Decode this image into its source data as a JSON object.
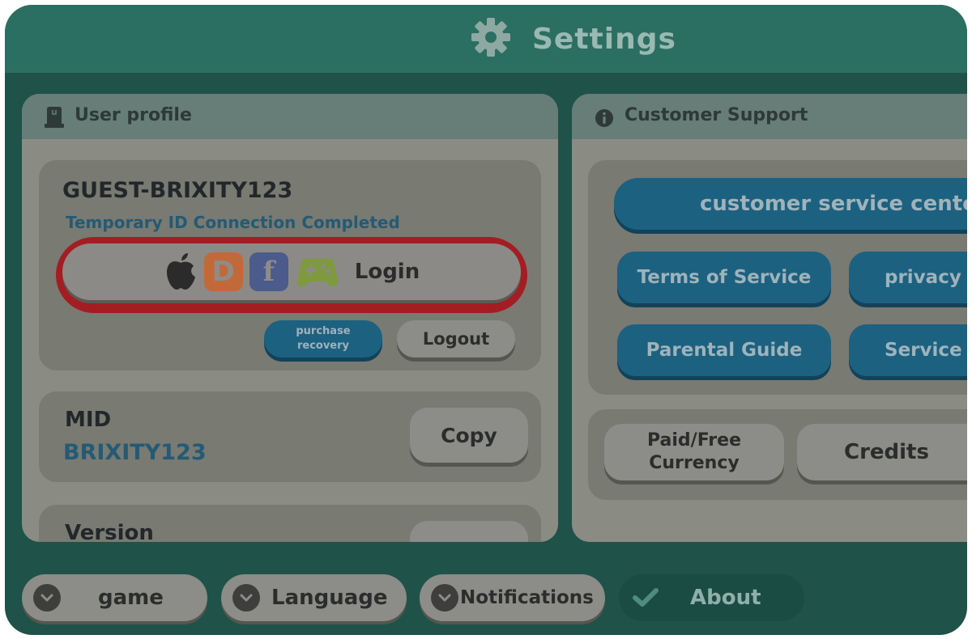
{
  "header": {
    "title": "Settings",
    "icon": "gear-icon"
  },
  "user_profile": {
    "title": "User profile",
    "username": "GUEST-BRIXITY123",
    "status": "Temporary ID Connection Completed",
    "login_label": "Login",
    "login_badge_d": "D",
    "login_badge_f": "f",
    "purchase_recovery_label": "purchase recovery",
    "logout_label": "Logout",
    "mid_label": "MID",
    "mid_value": "BRIXITY123",
    "copy_label": "Copy",
    "version_label": "Version"
  },
  "support": {
    "title": "Customer Support",
    "customer_service_label": "customer service cente",
    "terms_label": "Terms of Service",
    "privacy_label": "privacy",
    "parental_label": "Parental Guide",
    "service_label": "Service",
    "paid_free_label": "Paid/Free Currency",
    "credits_label": "Credits"
  },
  "tabs": [
    {
      "label": "game"
    },
    {
      "label": "Language"
    },
    {
      "label": "Notifications"
    },
    {
      "label": "About"
    }
  ],
  "colors": {
    "frame": "#1f5249",
    "titlebar": "#2b6f62",
    "highlight_ring": "#a31d22",
    "teal_button": "#1c6180",
    "active_tab": "#1b4c44"
  }
}
